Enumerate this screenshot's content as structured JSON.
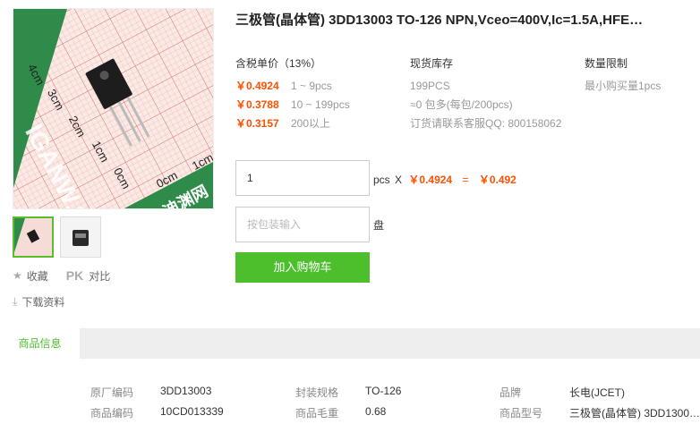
{
  "product": {
    "title": "三极管(晶体管) 3DD13003 TO-126 NPN,Vceo=400V,Ic=1.5A,HFE…"
  },
  "image_labels": {
    "ruler_marks": [
      "4cm",
      "3cm",
      "2cm",
      "1cm",
      "0cm",
      "0cm",
      "1cm"
    ],
    "watermark": "IGANW.COM",
    "logo_text": "迪渊网"
  },
  "pricing": {
    "header": "含税单价（13%）",
    "tiers": [
      {
        "price": "￥0.4924",
        "range": "1 ~ 9pcs"
      },
      {
        "price": "￥0.3788",
        "range": "10 ~ 199pcs"
      },
      {
        "price": "￥0.3157",
        "range": "200以上"
      }
    ]
  },
  "stock": {
    "header": "现货库存",
    "lines": [
      "199PCS",
      "≈0 包多(每包/200pcs)",
      "订货请联系客服QQ: 800158062"
    ]
  },
  "limit": {
    "header": "数量限制",
    "line": "最小购买量1pcs"
  },
  "order": {
    "qty_value": "1",
    "unit": "pcs",
    "times": "X",
    "unit_price": "￥0.4924",
    "equals": "=",
    "total": "￥0.492",
    "pack_placeholder": "按包装输入",
    "pack_unit": "盘",
    "add_to_cart": "加入购物车"
  },
  "actions": {
    "favorite": "收藏",
    "pk": "PK",
    "compare": "对比",
    "download": "下载资料"
  },
  "tabs": {
    "info": "商品信息"
  },
  "specs": {
    "rows": [
      [
        {
          "k": "原厂编码",
          "v": "3DD13003"
        },
        {
          "k": "封装规格",
          "v": "TO-126"
        },
        {
          "k": "品牌",
          "v": "长电(JCET)"
        }
      ],
      [
        {
          "k": "商品编码",
          "v": "10CD013339"
        },
        {
          "k": "商品毛重",
          "v": "0.68"
        },
        {
          "k": "商品型号",
          "v": "三极管(晶体管) 3DD1300…"
        }
      ]
    ]
  },
  "colors": {
    "accent_green": "#4dbf2c",
    "price_orange": "#ff5000"
  }
}
